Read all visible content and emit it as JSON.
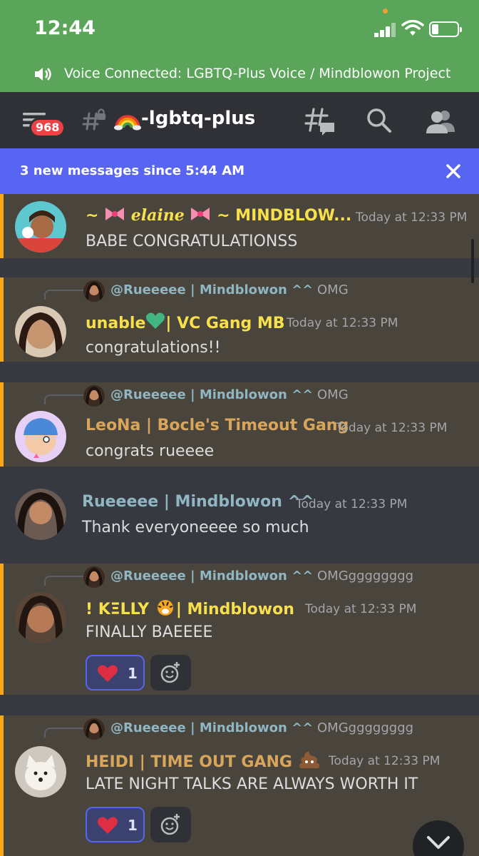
{
  "status_bar": {
    "time": "12:44"
  },
  "voice": {
    "text": "Voice Connected: LGBTQ-Plus Voice / Mindblowon Project"
  },
  "header": {
    "badge_count": "968",
    "channel_name": "-lgbtq-plus"
  },
  "new_messages": {
    "text": "3 new messages since 5:44 AM"
  },
  "messages": [
    {
      "author_pre": "~",
      "author_main": "elaine",
      "author_post": "~ MINDBLOW...",
      "author_color": "#f7e04b",
      "timestamp": "Today at 12:33 PM",
      "content": "BABE CONGRATULATIONSS"
    },
    {
      "reply_name": "@Rueeeee | Mindblowon ^^",
      "reply_content": "OMG",
      "author_pre": "unable",
      "author_post": "| VC Gang MB",
      "author_color": "#f7e04b",
      "timestamp": "Today at 12:33 PM",
      "content": "congratulations!!"
    },
    {
      "reply_name": "@Rueeeee | Mindblowon ^^",
      "reply_content": "OMG",
      "author": "LeoNa | Bocle's Timeout Gang",
      "author_color": "#d8a55d",
      "timestamp": "Today at 12:33 PM",
      "content": "congrats rueeee"
    },
    {
      "author": "Rueeeee | Mindblowon ^^",
      "author_color": "#8fb6c2",
      "timestamp": "Today at 12:33 PM",
      "content": "Thank everyoneeee so much"
    },
    {
      "reply_name": "@Rueeeee | Mindblowon ^^",
      "reply_content": "OMGgggggggg",
      "author_pre": "!   KΞLLY",
      "author_post": "| Mindblowon",
      "author_color": "#f7e04b",
      "timestamp": "Today at 12:33 PM",
      "content": "FINALLY BAEEEE",
      "reaction_count": "1"
    },
    {
      "reply_name": "@Rueeeee | Mindblowon ^^",
      "reply_content": "OMGgggggggg",
      "author": "HEIDI | TIME OUT GANG",
      "author_color": "#d8a55d",
      "timestamp": "Today at 12:33 PM",
      "content": "LATE NIGHT TALKS ARE ALWAYS WORTH IT",
      "reaction_count": "1"
    }
  ]
}
